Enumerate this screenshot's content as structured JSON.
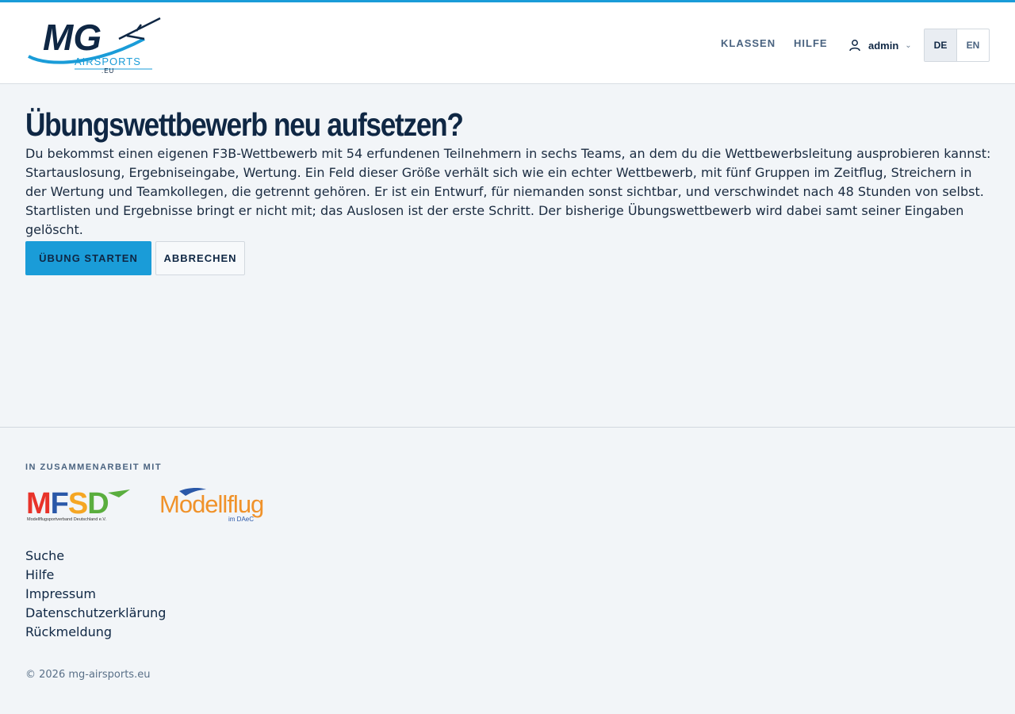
{
  "header": {
    "logo": {
      "mark": "MG",
      "word": "AIRSPORTS",
      "suffix": ".EU"
    },
    "nav": {
      "classes": "KLASSEN",
      "help": "HILFE"
    },
    "user": {
      "name": "admin",
      "chevron": "⌄"
    },
    "languages": [
      {
        "label": "DE",
        "active": true
      },
      {
        "label": "EN",
        "active": false
      }
    ]
  },
  "main": {
    "title": "Übungswettbewerb neu aufsetzen?",
    "intro": "Du bekommst einen eigenen F3B-Wettbewerb mit 54 erfundenen Teilnehmern in sechs Teams, an dem du die Wettbewerbsleitung ausprobieren kannst: Startauslosung, Ergebniseingabe, Wertung. Ein Feld dieser Größe verhält sich wie ein echter Wettbewerb, mit fünf Gruppen im Zeitflug, Streichern in der Wertung und Teamkollegen, die getrennt gehören. Er ist ein Entwurf, für niemanden sonst sichtbar, und verschwindet nach 48 Stunden von selbst. Startlisten und Ergebnisse bringt er nicht mit; das Auslosen ist der erste Schritt. Der bisherige Übungswettbewerb wird dabei samt seiner Eingaben gelöscht.",
    "buttons": {
      "start": "ÜBUNG STARTEN",
      "cancel": "ABBRECHEN"
    }
  },
  "footer": {
    "partner_label": "IN ZUSAMMENARBEIT MIT",
    "partners": {
      "mfsd": {
        "name": "MFSD",
        "subtitle": "Modellflugsportverband Deutschland e.V."
      },
      "modellflug": {
        "name": "Modellflug",
        "subtitle": "im DAeC"
      }
    },
    "links": [
      "Suche",
      "Hilfe",
      "Impressum",
      "Datenschutzerklärung",
      "Rückmeldung"
    ],
    "copyright": "© 2026 mg-airsports.eu"
  },
  "colors": {
    "accent": "#1a9cd8",
    "navy": "#0f2744",
    "background": "#f2f5f8"
  }
}
